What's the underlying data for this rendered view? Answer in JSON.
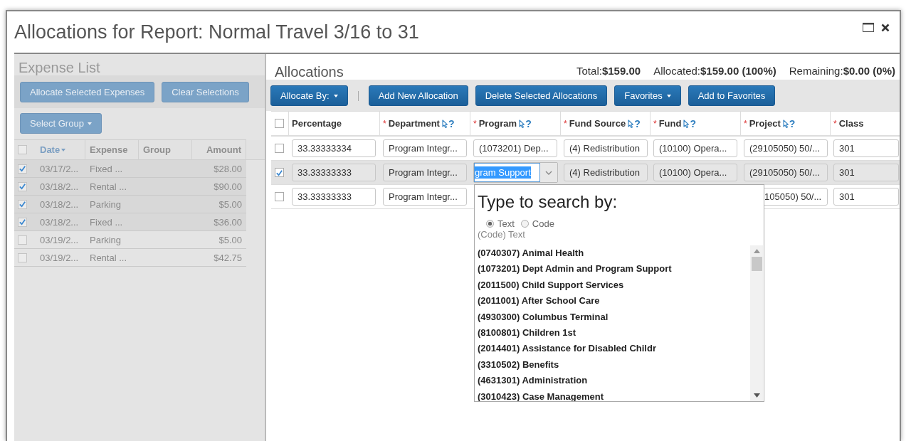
{
  "window": {
    "title": "Allocations for Report: Normal Travel 3/16 to 31"
  },
  "expense_list": {
    "title": "Expense List",
    "buttons": [
      {
        "label": "Allocate Selected Expenses"
      },
      {
        "label": "Clear Selections"
      }
    ],
    "select_group": {
      "label": "Select Group"
    },
    "table": {
      "all_checked": false,
      "columns": [
        {
          "label": "Date",
          "sorted": true
        },
        {
          "label": "Expense",
          "sorted": false
        },
        {
          "label": "Group",
          "sorted": false
        },
        {
          "label": "Amount",
          "sorted": false
        }
      ],
      "rows": [
        {
          "checked": true,
          "date": "03/17/2...",
          "expense": "Fixed ...",
          "amount": "$28.00"
        },
        {
          "checked": true,
          "date": "03/18/2...",
          "expense": "Rental ...",
          "amount": "$90.00"
        },
        {
          "checked": true,
          "date": "03/18/2...",
          "expense": "Parking",
          "amount": "$5.00"
        },
        {
          "checked": true,
          "date": "03/18/2...",
          "expense": "Fixed ...",
          "amount": "$36.00"
        },
        {
          "checked": false,
          "date": "03/19/2...",
          "expense": "Parking",
          "amount": "$5.00"
        },
        {
          "checked": false,
          "date": "03/19/2...",
          "expense": "Rental ...",
          "amount": "$42.75"
        }
      ]
    }
  },
  "allocations": {
    "title": "Allocations",
    "totals": [
      {
        "label": "Total:",
        "value": "$159.00"
      },
      {
        "label": "Allocated:",
        "value": "$159.00 (100%)"
      },
      {
        "label": "Remaining:",
        "value": "$0.00 (0%)"
      }
    ],
    "toolbar": [
      {
        "label": "Allocate By:",
        "dropdown": true
      },
      {
        "kind": "separator"
      },
      {
        "label": "Add New Allocation",
        "dropdown": false
      },
      {
        "label": "Delete Selected Allocations",
        "dropdown": false
      },
      {
        "label": "Favorites",
        "dropdown": true
      },
      {
        "label": "Add to Favorites",
        "dropdown": false
      }
    ],
    "table": {
      "all_checked": false,
      "columns": [
        {
          "label": "Percentage"
        },
        {
          "label": "Department",
          "required_mark": "*",
          "help": "?"
        },
        {
          "label": "Program",
          "required_mark": "*",
          "help": "?"
        },
        {
          "label": "Fund Source",
          "required_mark": "*",
          "help": "?"
        },
        {
          "label": "Fund",
          "required_mark": "*",
          "help": "?"
        },
        {
          "label": "Project",
          "required_mark": "*",
          "help": "?"
        },
        {
          "label": "Class",
          "required_mark": "*"
        }
      ],
      "rows": [
        {
          "checked": false,
          "cells": [
            {
              "value": "33.33333334"
            },
            {
              "value": "Program Integr..."
            },
            {
              "value": "(1073201) Dep..."
            },
            {
              "value": "(4) Redistribution"
            },
            {
              "value": "(10100) Opera..."
            },
            {
              "value": "(29105050) 50/..."
            },
            {
              "value": "301"
            }
          ]
        },
        {
          "checked": true,
          "cells": [
            {
              "value": "33.33333333"
            },
            {
              "value": "Program Integr..."
            },
            {
              "value": "gram Support",
              "kind": "combo"
            },
            {
              "value": "(4) Redistribution"
            },
            {
              "value": "(10100) Opera..."
            },
            {
              "value": "(29105050) 50/..."
            },
            {
              "value": "301"
            }
          ]
        },
        {
          "checked": false,
          "cells": [
            {
              "value": "33.33333333"
            },
            {
              "value": "Program Integr..."
            },
            {
              "kind": "covered"
            },
            {
              "kind": "covered"
            },
            {
              "kind": "covered"
            },
            {
              "value": "105050) 50/...",
              "kind": "partial"
            },
            {
              "value": "301"
            }
          ]
        }
      ]
    },
    "search_popup": {
      "title": "Type to search by:",
      "options": [
        {
          "label": "Text",
          "selected": true
        },
        {
          "label": "Code",
          "selected": false
        }
      ],
      "hint": "(Code) Text",
      "items": [
        "(0740307) Animal Health",
        "(1073201) Dept Admin and Program Support",
        "(2011500) Child Support Services",
        "(2011001) After School Care",
        "(4930300) Columbus Terminal",
        "(8100801) Children 1st",
        "(2014401) Assistance for Disabled Childr",
        "(3310502) Benefits",
        "(4631301) Administration",
        "(3010423) Case Management"
      ]
    }
  }
}
